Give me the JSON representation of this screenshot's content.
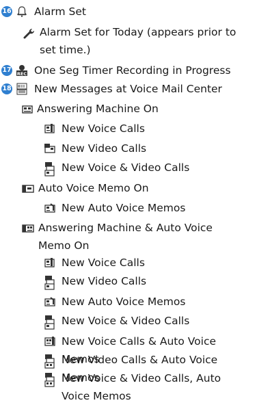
{
  "items": [
    {
      "num": "16",
      "label": "Alarm Set",
      "icon": "bell-icon"
    },
    {
      "label": "Alarm Set for Today (appears prior to set time.)",
      "icon": "wrench-alarm-icon"
    },
    {
      "num": "17",
      "label": "One Seg Timer Recording in Progress",
      "icon": "rec-icon"
    },
    {
      "num": "18",
      "label": "New Messages at Voice Mail Center",
      "icon": "voicemail-icon"
    },
    {
      "label": "Answering Machine On",
      "icon": "answering-machine-icon"
    },
    {
      "label": "New Voice Calls",
      "icon": "voice-call-icon"
    },
    {
      "label": "New Video Calls",
      "icon": "video-call-icon"
    },
    {
      "label": "New Voice & Video Calls",
      "icon": "voice-video-icon"
    },
    {
      "label": "Auto Voice Memo On",
      "icon": "auto-memo-icon"
    },
    {
      "label": "New Auto Voice Memos",
      "icon": "new-auto-memo-icon"
    },
    {
      "label": "Answering Machine & Auto Voice Memo On",
      "icon": "am-auto-memo-icon"
    },
    {
      "label": "New Voice Calls",
      "icon": "voice-call-icon"
    },
    {
      "label": "New Video Calls",
      "icon": "video-call-icon"
    },
    {
      "label": "New Auto Voice Memos",
      "icon": "new-auto-memo-icon"
    },
    {
      "label": "New Voice & Video Calls",
      "icon": "voice-video-icon"
    },
    {
      "label": "New Voice Calls & Auto Voice Memos",
      "icon": "voice-memo-icon"
    },
    {
      "label": "New Video Calls & Auto Voice Memos",
      "icon": "video-memo-icon"
    },
    {
      "label": "New Voice & Video Calls, Auto Voice Memos",
      "icon": "voice-video-memo-icon"
    }
  ]
}
